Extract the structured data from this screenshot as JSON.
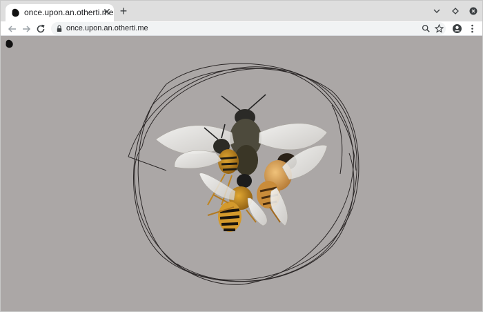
{
  "browser": {
    "tab": {
      "title": "once.upon.an.otherti.me",
      "favicon": "blob-icon",
      "close_symbol": "✕"
    },
    "new_tab_symbol": "+",
    "address_bar": {
      "url": "once.upon.an.otherti.me"
    }
  },
  "page": {
    "logo": "blob-icon",
    "illustration": "four bees in a hand-drawn circle",
    "background_color": "#aba7a6",
    "scribble_color": "#2a2626"
  }
}
